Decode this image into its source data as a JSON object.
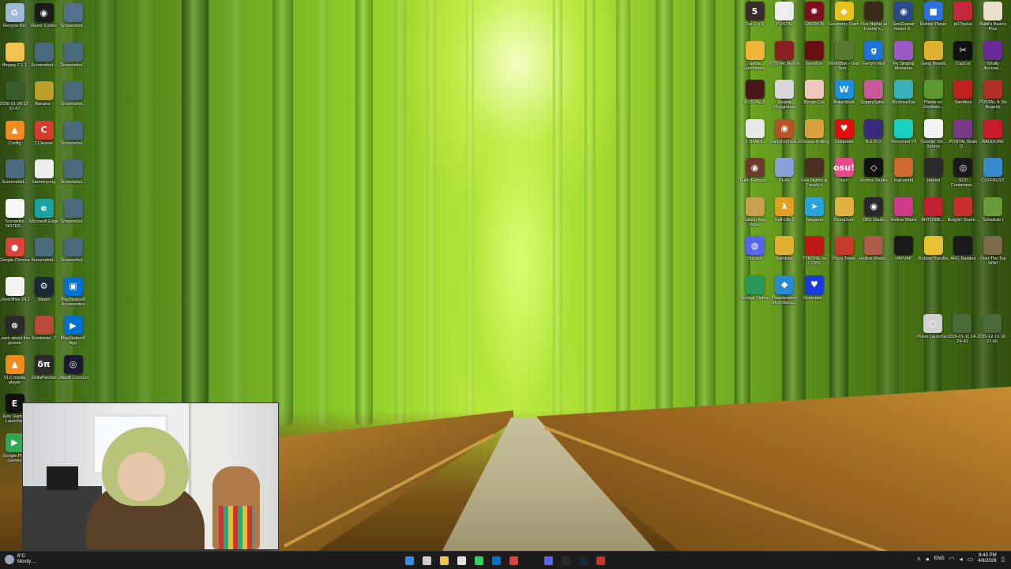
{
  "left_icons": [
    {
      "label": "Recycle Bin",
      "color": "#9fb9d8",
      "glyph": "♻",
      "icon": "recycle-bin-icon"
    },
    {
      "label": "Razer Cortex",
      "color": "#1b1b1b",
      "glyph": "◉",
      "icon": "razer-cortex-icon"
    },
    {
      "label": "Screenshot...",
      "color": "#55708a",
      "glyph": "",
      "icon": "screenshot-icon"
    },
    {
      "label": "ffmpeg-7.1.1",
      "color": "#f2c14e",
      "glyph": "",
      "icon": "folder-icon"
    },
    {
      "label": "Screenshot...",
      "color": "#4b6a7d",
      "glyph": "",
      "icon": "screenshot-icon"
    },
    {
      "label": "Screenshot...",
      "color": "#4b6a7d",
      "glyph": "",
      "icon": "screenshot-icon"
    },
    {
      "label": "2026-01-28 12-31-07",
      "color": "#385c2c",
      "glyph": "",
      "icon": "video-file-icon"
    },
    {
      "label": "Banana -",
      "color": "#b8a02a",
      "glyph": "",
      "icon": "banana-icon"
    },
    {
      "label": "Screenshot...",
      "color": "#4b6a7d",
      "glyph": "",
      "icon": "screenshot-icon"
    },
    {
      "label": "Config",
      "color": "#f28a1e",
      "glyph": "▲",
      "icon": "vlc-config-icon"
    },
    {
      "label": "CCleaner",
      "color": "#d63b2e",
      "glyph": "C",
      "icon": "ccleaner-icon"
    },
    {
      "label": "Screenshot...",
      "color": "#4b6a7d",
      "glyph": "",
      "icon": "screenshot-icon"
    },
    {
      "label": "Screenshot...",
      "color": "#4b6a7d",
      "glyph": "",
      "icon": "screenshot-icon"
    },
    {
      "label": "harmony.log",
      "color": "#eeeeee",
      "glyph": "",
      "icon": "text-file-icon"
    },
    {
      "label": "Screenshot...",
      "color": "#4b6a7d",
      "glyph": "",
      "icon": "screenshot-icon"
    },
    {
      "label": "Scenarios NOTEP...",
      "color": "#f7f7f7",
      "glyph": "",
      "icon": "text-file-icon"
    },
    {
      "label": "Microsoft Edge",
      "color": "#1aa3a3",
      "glyph": "e",
      "icon": "edge-icon"
    },
    {
      "label": "Screenshot...",
      "color": "#4b6a7d",
      "glyph": "",
      "icon": "screenshot-icon"
    },
    {
      "label": "Google Chrome",
      "color": "#db4437",
      "glyph": "●",
      "icon": "chrome-icon"
    },
    {
      "label": "Screenshot...",
      "color": "#4b6a7d",
      "glyph": "",
      "icon": "screenshot-icon"
    },
    {
      "label": "Screenshot...",
      "color": "#4b6a7d",
      "glyph": "",
      "icon": "screenshot-icon"
    },
    {
      "label": "LibreOffice 24.2",
      "color": "#f2f2f2",
      "glyph": "",
      "icon": "libreoffice-icon"
    },
    {
      "label": "Steam",
      "color": "#1b2838",
      "glyph": "⚙",
      "icon": "steam-icon"
    },
    {
      "label": "PlayStation® Accessories",
      "color": "#0070d1",
      "glyph": "▣",
      "icon": "playstation-accessories-icon"
    },
    {
      "label": "Learn about this picture",
      "color": "#2a2a2a",
      "glyph": "⊗",
      "icon": "learn-picture-icon"
    },
    {
      "label": "Zombieter_7",
      "color": "#b94a3a",
      "glyph": "",
      "icon": "zombie-icon"
    },
    {
      "label": "PlayStation® App",
      "color": "#0070d1",
      "glyph": "▶",
      "icon": "playstation-app-icon"
    },
    {
      "label": "VLC media player",
      "color": "#f28a1e",
      "glyph": "▲",
      "icon": "vlc-icon"
    },
    {
      "label": "DeltaPatcher",
      "color": "#2b2b2b",
      "glyph": "δπ",
      "icon": "deltapatcher-icon"
    },
    {
      "label": "Ubisoft Connect",
      "color": "#1a1a2e",
      "glyph": "◎",
      "icon": "ubisoft-icon"
    },
    {
      "label": "Epic Games Launcher",
      "color": "#111111",
      "glyph": "E",
      "icon": "epic-games-icon"
    },
    {
      "label": "Google Play Games",
      "color": "#2fa84f",
      "glyph": "▶",
      "icon": "google-play-games-icon"
    }
  ],
  "right_icons": [
    {
      "label": "Far Cry 5",
      "color": "#3a2c2c",
      "glyph": "5",
      "icon": "far-cry-icon"
    },
    {
      "label": "POSTAL",
      "color": "#ececec",
      "glyph": "☠",
      "icon": "postal-icon"
    },
    {
      "label": "CARRION",
      "color": "#7a1020",
      "glyph": "✺",
      "icon": "carrion-icon"
    },
    {
      "label": "Geometry Dash",
      "color": "#e4c41a",
      "glyph": "◆",
      "icon": "geometry-dash-icon"
    },
    {
      "label": "Five Nights at Freddy's...",
      "color": "#3a2a1a",
      "glyph": "",
      "icon": "fnaf-icon"
    },
    {
      "label": "GeoGuessr Steam E...",
      "color": "#2d4a8a",
      "glyph": "◉",
      "icon": "geoguessr-icon"
    },
    {
      "label": "Roblox Player",
      "color": "#2b6fe0",
      "glyph": "■",
      "icon": "roblox-player-icon"
    },
    {
      "label": "pt1Toplus",
      "color": "#c5283d",
      "glyph": "",
      "icon": "pizza-tower-plus-icon"
    },
    {
      "label": "Baldi's Basics Plus",
      "color": "#e8e0c8",
      "glyph": "",
      "icon": "baldis-basics-icon"
    },
    {
      "label": "Game Ranchinerrr",
      "color": "#f0b53a",
      "glyph": "",
      "icon": "game-icon"
    },
    {
      "label": "POSTAL Redux",
      "color": "#8a2020",
      "glyph": "",
      "icon": "postal-redux-icon"
    },
    {
      "label": "GoreBox",
      "color": "#6a0e14",
      "glyph": "",
      "icon": "gorebox-icon"
    },
    {
      "label": "WorldBox - God Sim...",
      "color": "#5a7a30",
      "glyph": "",
      "icon": "worldbox-icon"
    },
    {
      "label": "Garry's Mod",
      "color": "#1e73d6",
      "glyph": "g",
      "icon": "garrys-mod-icon"
    },
    {
      "label": "My Singing Monsters",
      "color": "#9b5ac8",
      "glyph": "",
      "icon": "my-singing-monsters-icon"
    },
    {
      "label": "Gang Beasts",
      "color": "#e0b030",
      "glyph": "",
      "icon": "gang-beasts-icon"
    },
    {
      "label": "CapCut",
      "color": "#111111",
      "glyph": "✂",
      "icon": "capcut-icon"
    },
    {
      "label": "Totally Accurat...",
      "color": "#6a2a9a",
      "glyph": "",
      "icon": "tabs-icon"
    },
    {
      "label": "POSTAL 2",
      "color": "#4a1818",
      "glyph": "",
      "icon": "postal-2-icon"
    },
    {
      "label": "People Playground",
      "color": "#d8d8d8",
      "glyph": "",
      "icon": "people-playground-icon"
    },
    {
      "label": "Bongo Cat",
      "color": "#f0c8c0",
      "glyph": "",
      "icon": "bongo-cat-icon"
    },
    {
      "label": "AnkerWork",
      "color": "#1c8fe0",
      "glyph": "W",
      "icon": "ankerwork-icon"
    },
    {
      "label": "SugarySpire...",
      "color": "#c85a9a",
      "glyph": "",
      "icon": "sugary-spire-icon"
    },
    {
      "label": "MyVoiceZoo",
      "color": "#3ab0b8",
      "glyph": "",
      "icon": "myvoicezoo-icon"
    },
    {
      "label": "Plants vs. Zombies...",
      "color": "#5a9a30",
      "glyph": "",
      "icon": "pvz-icon"
    },
    {
      "label": "Sandbox",
      "color": "#c02020",
      "glyph": "",
      "icon": "sandbox-icon"
    },
    {
      "label": "POSTAL 4: No Regerts",
      "color": "#b03028",
      "glyph": "",
      "icon": "postal-4-icon"
    },
    {
      "label": "ULTRAKILL",
      "color": "#e8e8e8",
      "glyph": "",
      "icon": "ultrakill-icon"
    },
    {
      "label": "Team Fortress 2",
      "color": "#b5542a",
      "glyph": "◉",
      "icon": "team-fortress-2-icon"
    },
    {
      "label": "Cheese Rolling",
      "color": "#d8a040",
      "glyph": "",
      "icon": "cheese-rolling-icon"
    },
    {
      "label": "Undertale",
      "color": "#e01010",
      "glyph": "♥",
      "icon": "undertale-icon"
    },
    {
      "label": "R.E.P.O.",
      "color": "#3a2a7a",
      "glyph": "",
      "icon": "repo-icon"
    },
    {
      "label": "Voicemod V3",
      "color": "#1ad0c0",
      "glyph": "",
      "icon": "voicemod-icon"
    },
    {
      "label": "Counter-Str... Source",
      "color": "#f2f2f2",
      "glyph": "",
      "icon": "counter-strike-icon"
    },
    {
      "label": "POSTAL Brain D...",
      "color": "#7a3a8a",
      "glyph": "",
      "icon": "postal-brain-damaged-icon"
    },
    {
      "label": "RAGDORE",
      "color": "#c81a2a",
      "glyph": "",
      "icon": "ragdore-icon"
    },
    {
      "label": "Team Fortress...",
      "color": "#6a3a2a",
      "glyph": "◉",
      "icon": "team-fortress-classic-icon"
    },
    {
      "label": "PEAK",
      "color": "#8aa0d8",
      "glyph": "",
      "icon": "peak-icon"
    },
    {
      "label": "Five Nights at Freddy's",
      "color": "#4a3020",
      "glyph": "",
      "icon": "fnaf-2-icon"
    },
    {
      "label": "osu!",
      "color": "#e84a8a",
      "glyph": "osu!",
      "icon": "osu-icon"
    },
    {
      "label": "Roblox Studio",
      "color": "#111111",
      "glyph": "◇",
      "icon": "roblox-studio-icon"
    },
    {
      "label": "fnaf-world",
      "color": "#d06a30",
      "glyph": "",
      "icon": "fnaf-world-icon"
    },
    {
      "label": "Hatred",
      "color": "#2a2a2a",
      "glyph": "",
      "icon": "hatred-icon"
    },
    {
      "label": "SCP Containme...",
      "color": "#1a1a1a",
      "glyph": "◎",
      "icon": "scp-icon"
    },
    {
      "label": "CUFFBUST",
      "color": "#3a8ad0",
      "glyph": "",
      "icon": "cuffbust-icon"
    },
    {
      "label": "Fallout: New Vegas",
      "color": "#c8a050",
      "glyph": "",
      "icon": "fallout-icon"
    },
    {
      "label": "Half-Life 2",
      "color": "#e0a020",
      "glyph": "λ",
      "icon": "half-life-2-icon"
    },
    {
      "label": "Telegram",
      "color": "#2aa3dc",
      "glyph": "➤",
      "icon": "telegram-icon"
    },
    {
      "label": "PizzaOven",
      "color": "#e0b040",
      "glyph": "",
      "icon": "pizza-oven-icon"
    },
    {
      "label": "OBS Studio",
      "color": "#2a2a2a",
      "glyph": "◉",
      "icon": "obs-icon"
    },
    {
      "label": "Hotline Miami",
      "color": "#d03a8a",
      "glyph": "",
      "icon": "hotline-miami-icon"
    },
    {
      "label": "ANTONBL...",
      "color": "#c02030",
      "glyph": "",
      "icon": "antonblast-icon"
    },
    {
      "label": "Burglin' Gnom...",
      "color": "#c83030",
      "glyph": "",
      "icon": "burglin-gnomes-icon"
    },
    {
      "label": "Schedule I",
      "color": "#6a9a3a",
      "glyph": "",
      "icon": "schedule-i-icon"
    },
    {
      "label": "Discord",
      "color": "#5865f2",
      "glyph": "◍",
      "icon": "discord-icon"
    },
    {
      "label": "Teardown",
      "color": "#e0b030",
      "glyph": "",
      "icon": "teardown-icon"
    },
    {
      "label": "TYRONE vs COPS",
      "color": "#c01818",
      "glyph": "",
      "icon": "tyrone-vs-cops-icon"
    },
    {
      "label": "Pizza Tower",
      "color": "#c83a2a",
      "glyph": "",
      "icon": "pizza-tower-icon"
    },
    {
      "label": "Hotline Miami...",
      "color": "#b05a4a",
      "glyph": "",
      "icon": "hotline-miami-2-icon"
    },
    {
      "label": "VAPVAP",
      "color": "#1a1a1a",
      "glyph": "",
      "icon": "vapvap-icon"
    },
    {
      "label": "Rubber Bandits",
      "color": "#e8c030",
      "glyph": "",
      "icon": "rubber-bandits-icon"
    },
    {
      "label": "ARC Raiders",
      "color": "#1a1a1a",
      "glyph": "",
      "icon": "arc-raiders-icon"
    },
    {
      "label": "Over The Top WWI",
      "color": "#7a6a4a",
      "glyph": "",
      "icon": "over-the-top-icon"
    },
    {
      "label": "Nuclear Option",
      "color": "#2a9a5a",
      "glyph": "",
      "icon": "nuclear-option-icon"
    },
    {
      "label": "Thunderstore Mod Mana...",
      "color": "#2a8ad0",
      "glyph": "◆",
      "icon": "thunderstore-icon"
    },
    {
      "label": "Undertale...",
      "color": "#1a3ae0",
      "glyph": "♥",
      "icon": "undertale-2-icon"
    },
    {
      "label": "Prism Launcher",
      "color": "#d0d0d0",
      "glyph": "⬡",
      "icon": "prism-launcher-icon"
    },
    {
      "label": "2026-01-11 14-24-43",
      "color": "#4a6a3a",
      "glyph": "",
      "icon": "video-file-icon"
    },
    {
      "label": "2025-12-15 16-27-40",
      "color": "#4a6a3a",
      "glyph": "",
      "icon": "video-file-icon"
    }
  ],
  "taskbar": {
    "weather_temp": "8°C",
    "weather_desc": "Mostly ...",
    "lang": "ENG",
    "time": "6:45 PM",
    "date": "4/6/2026",
    "apps": [
      {
        "icon": "start-icon",
        "color": "#2f8ff0"
      },
      {
        "icon": "search-icon",
        "color": "#cfcfcf"
      },
      {
        "icon": "file-explorer-icon",
        "color": "#f2c14e"
      },
      {
        "icon": "task-view-icon",
        "color": "#e0e0e0"
      },
      {
        "icon": "whatsapp-icon",
        "color": "#25d366"
      },
      {
        "icon": "playstation-app-icon",
        "color": "#0070d1"
      },
      {
        "icon": "chrome-icon",
        "color": "#db4437"
      },
      {
        "icon": "gap-icon",
        "color": "#1c1c1c"
      },
      {
        "icon": "discord-icon",
        "color": "#5865f2"
      },
      {
        "icon": "terminal-icon",
        "color": "#2a2a2a"
      },
      {
        "icon": "steam-icon",
        "color": "#1b2838"
      },
      {
        "icon": "screen-recorder-icon",
        "color": "#d03030"
      }
    ]
  }
}
